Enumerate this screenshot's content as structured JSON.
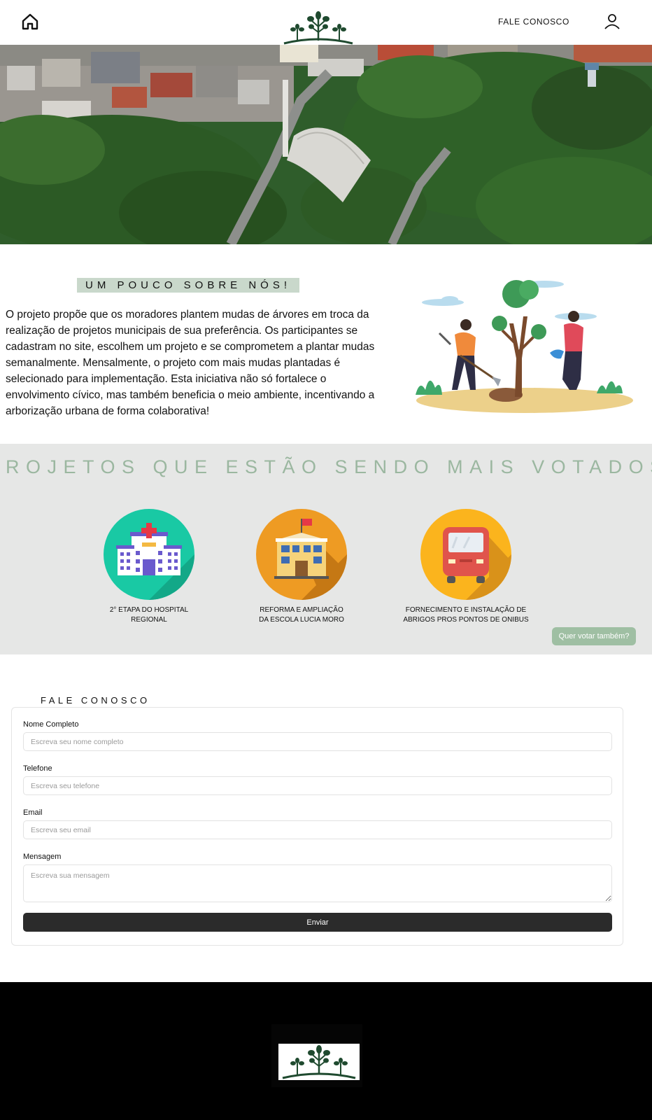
{
  "header": {
    "nav_contact": "FALE CONOSCO"
  },
  "icons": {
    "home": "home-icon",
    "user": "user-icon",
    "logo": "tree-logo"
  },
  "about": {
    "title": "UM POUCO SOBRE NÓS!",
    "text": "O projeto propõe que os moradores plantem mudas de árvores em troca da realização de projetos municipais de sua preferência. Os participantes se cadastram no site, escolhem um projeto e se comprometem a plantar mudas semanalmente. Mensalmente, o projeto com mais mudas plantadas é selecionado para implementação. Esta iniciativa não só fortalece o envolvimento cívico, mas também beneficia o meio ambiente, incentivando a arborização urbana de forma colaborativa!"
  },
  "projects": {
    "title": "ROJETOS QUE ESTÃO SENDO MAIS  VOTADOS",
    "items": [
      {
        "line1": "2° ETAPA DO HOSPITAL",
        "line2": "REGIONAL"
      },
      {
        "line1": "REFORMA E AMPLIAÇÃO",
        "line2": "DA ESCOLA LUCIA MORO"
      },
      {
        "line1": "FORNECIMENTO E INSTALAÇÃO DE",
        "line2": "ABRIGOS PROS PONTOS DE ONIBUS"
      }
    ],
    "vote_button": "Quer votar também?"
  },
  "contact": {
    "title": "FALE CONOSCO",
    "name_label": "Nome Completo",
    "name_placeholder": "Escreva seu nome completo",
    "phone_label": "Telefone",
    "phone_placeholder": "Escreva seu telefone",
    "email_label": "Email",
    "email_placeholder": "Escreva seu email",
    "message_label": "Mensagem",
    "message_placeholder": "Escreva sua mensagem",
    "submit": "Enviar"
  },
  "colors": {
    "accent_green": "#9fbfa3",
    "title_green": "#9bb7a0",
    "about_band": "#c9d8cb",
    "logo_green": "#1f4a2f",
    "projects_bg": "#e6e7e6",
    "footer_bg": "#000000"
  }
}
